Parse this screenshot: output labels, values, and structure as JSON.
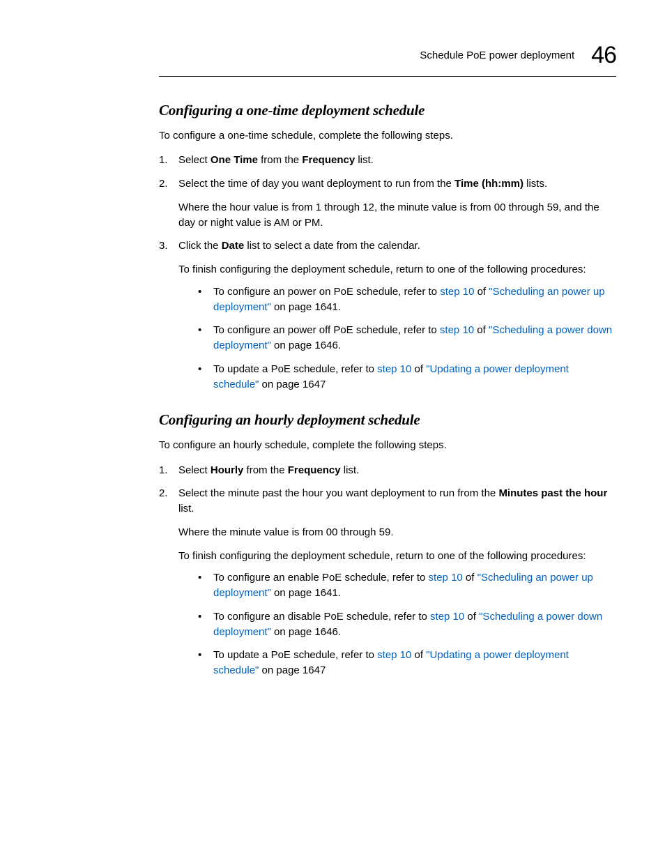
{
  "header": {
    "runningTitle": "Schedule PoE power deployment",
    "chapterNumber": "46"
  },
  "section1": {
    "title": "Configuring a one-time deployment schedule",
    "lead": "To configure a one-time schedule, complete the following steps.",
    "step1_pre": "Select ",
    "step1_b1": "One Time",
    "step1_mid": " from the ",
    "step1_b2": "Frequency",
    "step1_post": " list.",
    "step2_pre": "Select the time of day you want deployment to run from the ",
    "step2_b1": "Time (hh:mm)",
    "step2_post": " lists.",
    "step2_sub": "Where the hour value is from 1 through 12, the minute value is from 00 through 59, and the day or night value is AM or PM.",
    "step3_pre": "Click the ",
    "step3_b1": "Date",
    "step3_post": " list to select a date from the calendar.",
    "step3_sub": "To finish configuring the deployment schedule, return to one of the following procedures:",
    "b1_pre": "To configure an power on PoE schedule, refer to ",
    "b1_link1": "step 10",
    "b1_mid": " of ",
    "b1_link2": "\"Scheduling an power up deployment\"",
    "b1_post": " on page 1641.",
    "b2_pre": "To configure an power off PoE schedule, refer to ",
    "b2_link1": "step 10",
    "b2_mid": " of ",
    "b2_link2": "\"Scheduling a power down deployment\"",
    "b2_post": " on page 1646.",
    "b3_pre": "To update a PoE schedule, refer to ",
    "b3_link1": "step 10",
    "b3_mid": " of ",
    "b3_link2": "\"Updating a power deployment schedule\"",
    "b3_post": " on page 1647"
  },
  "section2": {
    "title": "Configuring an hourly deployment schedule",
    "lead": "To configure an hourly schedule, complete the following steps.",
    "step1_pre": "Select ",
    "step1_b1": "Hourly",
    "step1_mid": " from the ",
    "step1_b2": "Frequency",
    "step1_post": " list.",
    "step2_pre": "Select the minute past the hour you want deployment to run from the ",
    "step2_b1": "Minutes past the hour",
    "step2_post": " list.",
    "step2_sub": "Where the minute value is from 00 through 59.",
    "finish": "To finish configuring the deployment schedule, return to one of the following procedures:",
    "b1_pre": "To configure an enable PoE schedule, refer to ",
    "b1_link1": "step 10",
    "b1_mid": " of ",
    "b1_link2": "\"Scheduling an power up deployment\"",
    "b1_post": " on page 1641.",
    "b2_pre": "To configure an disable PoE schedule, refer to ",
    "b2_link1": "step 10",
    "b2_mid": " of ",
    "b2_link2": "\"Scheduling a power down deployment\"",
    "b2_post": " on page 1646.",
    "b3_pre": "To update a PoE schedule, refer to ",
    "b3_link1": "step 10",
    "b3_mid": " of ",
    "b3_link2": "\"Updating a power deployment schedule\"",
    "b3_post": " on page 1647"
  }
}
